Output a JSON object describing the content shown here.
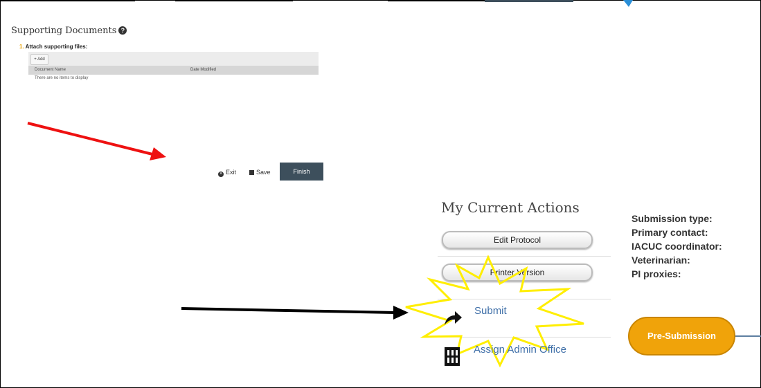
{
  "supporting_documents": {
    "title": "Supporting Documents",
    "question_number": "1.",
    "question_label": "Attach supporting files:",
    "add_label": "+ Add",
    "columns": [
      "Document Name",
      "Date Modified"
    ],
    "empty_text": "There are no items to display"
  },
  "footer_buttons": {
    "exit_label": "Exit",
    "save_label": "Save",
    "finish_label": "Finish"
  },
  "current_actions": {
    "title": "My Current Actions",
    "edit_protocol_label": "Edit Protocol",
    "printer_version_label": "Printer Version",
    "submit_label": "Submit",
    "assign_admin_office_label": "Assign Admin Office"
  },
  "protocol_info": {
    "labels": [
      "Submission type:",
      "Primary contact:",
      "IACUC coordinator:",
      "Veterinarian:",
      "PI proxies:"
    ]
  },
  "workflow": {
    "state_label": "Pre-Submission",
    "state_color": "#f0a30a"
  },
  "annotations": {
    "red_arrow_color": "#ee1111",
    "black_arrow_color": "#000000",
    "starburst_color": "#ffee00"
  }
}
